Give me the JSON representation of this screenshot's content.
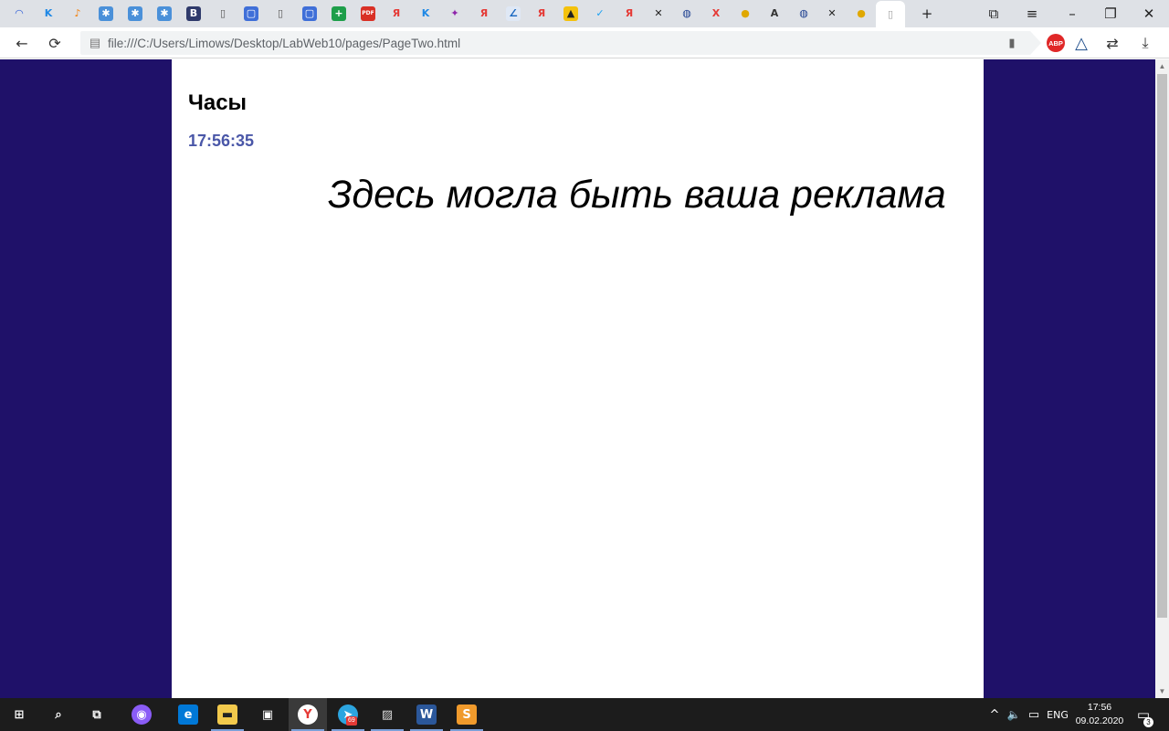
{
  "browser": {
    "tabs": [
      {
        "icon": "wave-icon",
        "glyph": "◠",
        "color": "#2a5bd7",
        "bg": "transparent"
      },
      {
        "icon": "k-icon",
        "glyph": "K",
        "color": "#1e88e5",
        "bg": "transparent"
      },
      {
        "icon": "music-icon",
        "glyph": "♪",
        "color": "#f57c00",
        "bg": "transparent"
      },
      {
        "icon": "gear-square-icon",
        "glyph": "✱",
        "color": "#ffffff",
        "bg": "#4a90d9"
      },
      {
        "icon": "gear-square-icon",
        "glyph": "✱",
        "color": "#ffffff",
        "bg": "#4a90d9"
      },
      {
        "icon": "gear-square-icon",
        "glyph": "✱",
        "color": "#ffffff",
        "bg": "#4a90d9"
      },
      {
        "icon": "vb-icon",
        "glyph": "B",
        "color": "#ffffff",
        "bg": "#2f3a6b"
      },
      {
        "icon": "document-icon",
        "glyph": "▯",
        "color": "#555555",
        "bg": "transparent"
      },
      {
        "icon": "chat-icon",
        "glyph": "▢",
        "color": "#ffffff",
        "bg": "#3f6fd8"
      },
      {
        "icon": "document-icon",
        "glyph": "▯",
        "color": "#555555",
        "bg": "transparent"
      },
      {
        "icon": "chat-icon",
        "glyph": "▢",
        "color": "#ffffff",
        "bg": "#3f6fd8"
      },
      {
        "icon": "plus-green-icon",
        "glyph": "+",
        "color": "#ffffff",
        "bg": "#1e9e4a"
      },
      {
        "icon": "pdf-icon",
        "glyph": "PDF",
        "color": "#ffffff",
        "bg": "#d93025"
      },
      {
        "icon": "yandex-icon",
        "glyph": "Я",
        "color": "#e53935",
        "bg": "transparent"
      },
      {
        "icon": "k-icon",
        "glyph": "K",
        "color": "#1e88e5",
        "bg": "transparent"
      },
      {
        "icon": "star-colorful-icon",
        "glyph": "✦",
        "color": "#8e24aa",
        "bg": "transparent"
      },
      {
        "icon": "yandex-icon",
        "glyph": "Я",
        "color": "#e53935",
        "bg": "transparent"
      },
      {
        "icon": "math-icon",
        "glyph": "∠",
        "color": "#1565c0",
        "bg": "#dfe8f5"
      },
      {
        "icon": "yandex-icon",
        "glyph": "Я",
        "color": "#e53935",
        "bg": "transparent"
      },
      {
        "icon": "image-icon",
        "glyph": "▲",
        "color": "#222222",
        "bg": "#f4c20d"
      },
      {
        "icon": "twitter-icon",
        "glyph": "✓",
        "color": "#1da1f2",
        "bg": "transparent"
      },
      {
        "icon": "yandex-icon",
        "glyph": "Я",
        "color": "#e53935",
        "bg": "transparent"
      },
      {
        "icon": "tools-icon",
        "glyph": "✕",
        "color": "#222222",
        "bg": "transparent"
      },
      {
        "icon": "globe-icon",
        "glyph": "◍",
        "color": "#1a3d8f",
        "bg": "transparent"
      },
      {
        "icon": "runner-icon",
        "glyph": "X",
        "color": "#e53935",
        "bg": "transparent"
      },
      {
        "icon": "badge-icon",
        "glyph": "●",
        "color": "#e0a800",
        "bg": "transparent"
      },
      {
        "icon": "font-icon",
        "glyph": "A",
        "color": "#333333",
        "bg": "transparent"
      },
      {
        "icon": "globe-icon",
        "glyph": "◍",
        "color": "#1a3d8f",
        "bg": "transparent"
      },
      {
        "icon": "tools-icon",
        "glyph": "✕",
        "color": "#222222",
        "bg": "transparent"
      },
      {
        "icon": "badge-icon",
        "glyph": "●",
        "color": "#e0a800",
        "bg": "transparent"
      },
      {
        "icon": "page-icon",
        "glyph": "▯",
        "color": "#9e9e9e",
        "bg": "transparent",
        "active": true
      }
    ],
    "new_tab_glyph": "+",
    "window_controls": {
      "collections": "⧉",
      "menu": "≡",
      "minimize": "–",
      "restore": "❐",
      "close": "✕"
    },
    "address": {
      "url": "file:///C:/Users/Limows/Desktop/LabWeb10/pages/PageTwo.html",
      "page_icon": "▤",
      "bookmark_glyph": "▮"
    },
    "nav": {
      "back": "←",
      "reload": "⟳"
    },
    "extensions": {
      "abp_label": "ABP",
      "alice": "△",
      "translate": "⇄",
      "download": "⤓"
    }
  },
  "page": {
    "background_color": "#1f1169",
    "heading": "Часы",
    "clock_time": "17:56:35",
    "clock_color": "#4a57a8",
    "ad_text": "Здесь могла быть ваша реклама"
  },
  "taskbar": {
    "apps": [
      {
        "name": "start-icon",
        "glyph": "⊞",
        "color": "#ffffff",
        "bg": "transparent"
      },
      {
        "name": "search-icon",
        "glyph": "⌕",
        "color": "#ffffff",
        "bg": "transparent"
      },
      {
        "name": "task-view-icon",
        "glyph": "⧉",
        "color": "#ffffff",
        "bg": "transparent"
      },
      {
        "name": "alice-icon",
        "glyph": "◉",
        "color": "#ffffff",
        "bg": "#8a5cf6"
      },
      {
        "name": "edge-icon",
        "glyph": "e",
        "color": "#ffffff",
        "bg": "#0078d7"
      },
      {
        "name": "explorer-icon",
        "glyph": "▬",
        "color": "#222222",
        "bg": "#f2c94c"
      },
      {
        "name": "store-icon",
        "glyph": "▣",
        "color": "#ffffff",
        "bg": "transparent"
      },
      {
        "name": "yandex-browser-icon",
        "glyph": "Y",
        "color": "#e53935",
        "bg": "#ffffff"
      },
      {
        "name": "telegram-icon",
        "glyph": "➤",
        "color": "#ffffff",
        "bg": "#2ca5e0"
      },
      {
        "name": "photos-icon",
        "glyph": "▨",
        "color": "#dddddd",
        "bg": "transparent"
      },
      {
        "name": "word-icon",
        "glyph": "W",
        "color": "#ffffff",
        "bg": "#2b579a"
      },
      {
        "name": "sublime-icon",
        "glyph": "S",
        "color": "#ffffff",
        "bg": "#f09a2c"
      }
    ],
    "telegram_badge": "69",
    "tray": {
      "chevron": "^",
      "volume": "🔈",
      "network": "▭",
      "language": "ENG",
      "time": "17:56",
      "date": "09.02.2020",
      "notifications_glyph": "▭",
      "notifications_count": "3"
    }
  }
}
